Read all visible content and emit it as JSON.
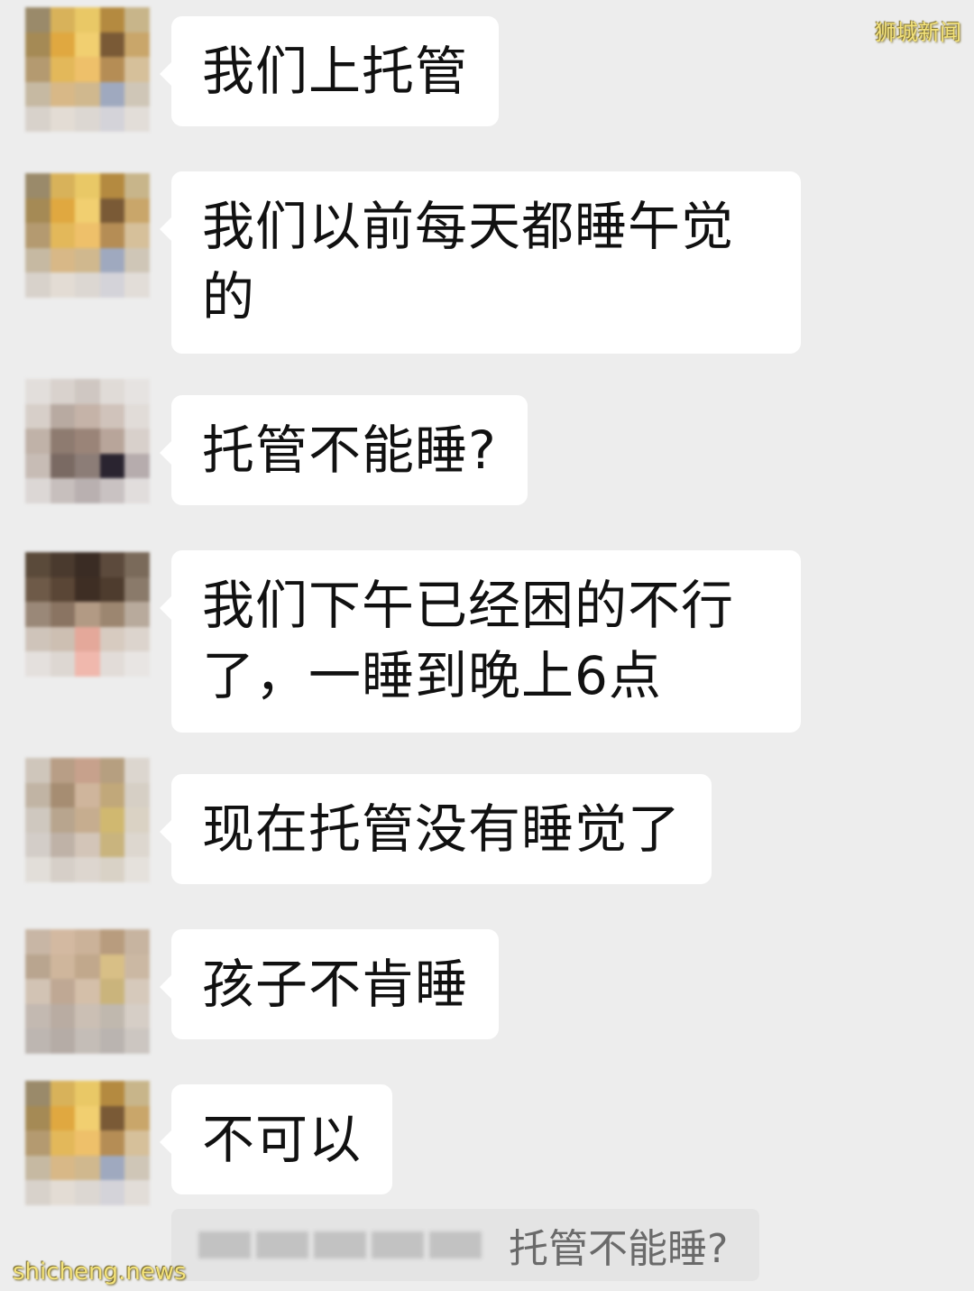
{
  "watermarks": {
    "top_right": "狮城新闻",
    "bottom_left": "shicheng.news"
  },
  "messages": [
    {
      "text": "我们上托管"
    },
    {
      "text": "我们以前每天都睡午觉的"
    },
    {
      "text": "托管不能睡?"
    },
    {
      "text": "我们下午已经困的不行了，一睡到晚上6点"
    },
    {
      "text": "现在托管没有睡觉了"
    },
    {
      "text": "孩子不肯睡"
    },
    {
      "text": "不可以"
    }
  ],
  "quote": {
    "text": "托管不能睡?"
  },
  "colors": {
    "background": "#ededed",
    "bubble": "#ffffff",
    "quote_background": "#e4e4e4",
    "watermark": "#f3e27a"
  }
}
